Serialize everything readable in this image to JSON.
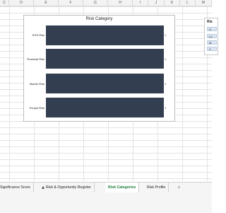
{
  "columns": [
    "C",
    "D",
    "E",
    "F",
    "G",
    "H",
    "I",
    "J",
    "K",
    "L",
    "M"
  ],
  "chart": {
    "title": "Risk Category",
    "categories": [
      "EHS Risk",
      "Financial Risk",
      "Market Risk",
      "People Risk"
    ],
    "values": [
      1,
      1,
      1,
      1
    ],
    "bar_color": "#333f50"
  },
  "chart_data": {
    "type": "bar",
    "title": "Risk Category",
    "categories": [
      "EHS Risk",
      "Financial Risk",
      "Market Risk",
      "People Risk"
    ],
    "values": [
      1,
      1,
      1,
      1
    ],
    "orientation": "horizontal"
  },
  "slicer": {
    "title": "Ris",
    "items": [
      "H",
      "Lo",
      "M",
      "V"
    ]
  },
  "tabs": [
    {
      "label": "Significance Score"
    },
    {
      "label": "Risk & Opportunity Register",
      "locked": true
    },
    {
      "label": "Risk Categories",
      "active": true
    },
    {
      "label": "Risk Profile"
    }
  ],
  "add_tab_label": "+"
}
